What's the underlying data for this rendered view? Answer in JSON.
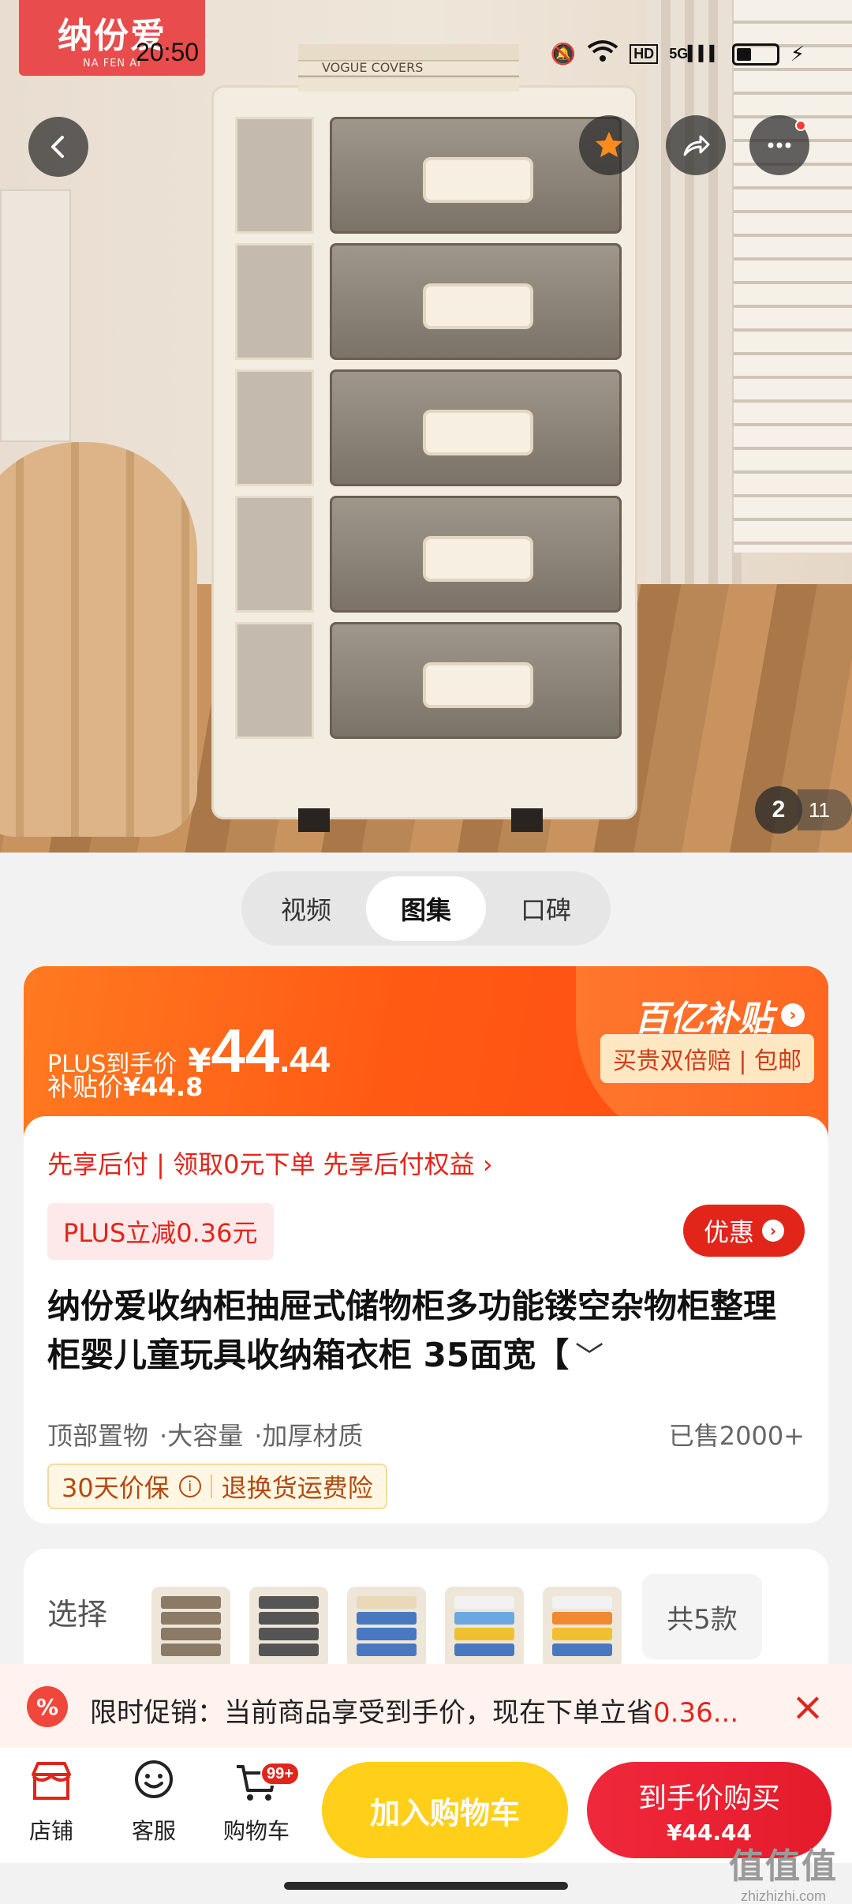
{
  "status": {
    "time": "20:50",
    "network": "5G",
    "hd": "HD"
  },
  "app_logo": {
    "cn": "纳份爱",
    "en": "NA FEN AI"
  },
  "hero": {
    "book_text": "VOGUE COVERS",
    "page_current": "2",
    "page_total": "11"
  },
  "media_tabs": [
    {
      "label": "视频"
    },
    {
      "label": "图集"
    },
    {
      "label": "口碑"
    }
  ],
  "price": {
    "plus_label": "PLUS到手价",
    "currency": "¥",
    "integer": "44",
    "decimal": ".44",
    "subsidy_label": "补贴价",
    "subsidy_price": "¥44.8",
    "campaign": "百亿补贴",
    "campaign_tags": "买贵双倍赔 | 包邮"
  },
  "product": {
    "pay_later": "先享后付 | 领取0元下单 先享后付权益 ›",
    "plus_discount": "PLUS立减0.36元",
    "deal_label": "优惠",
    "title": "纳份爱收纳柜抽屉式储物柜多功能镂空杂物柜整理柜婴儿童玩具收纳箱衣柜 35面宽【",
    "features": [
      "顶部置物",
      "·大容量",
      "·加厚材质"
    ],
    "sold": "已售2000+",
    "guarantee_1": "30天价保",
    "guarantee_2": "退换货运费险"
  },
  "variants": {
    "label": "选择",
    "count": "共5款"
  },
  "promo": {
    "icon": "%",
    "text_prefix": "限时促销：当前商品享受到手价，现在下单立省",
    "text_highlight": "0.36..."
  },
  "bottom": {
    "shop": "店铺",
    "service": "客服",
    "cart": "购物车",
    "cart_badge": "99+",
    "add_cart": "加入购物车",
    "buy_label": "到手价购买",
    "buy_price": "¥44.44"
  },
  "watermark": {
    "cn": "值值值",
    "en": "zhizhizhi.com"
  },
  "colors": {
    "accent_red": "#e1251b",
    "banner_orange": "#ff5a14",
    "cart_yellow": "#ffcf1a"
  }
}
